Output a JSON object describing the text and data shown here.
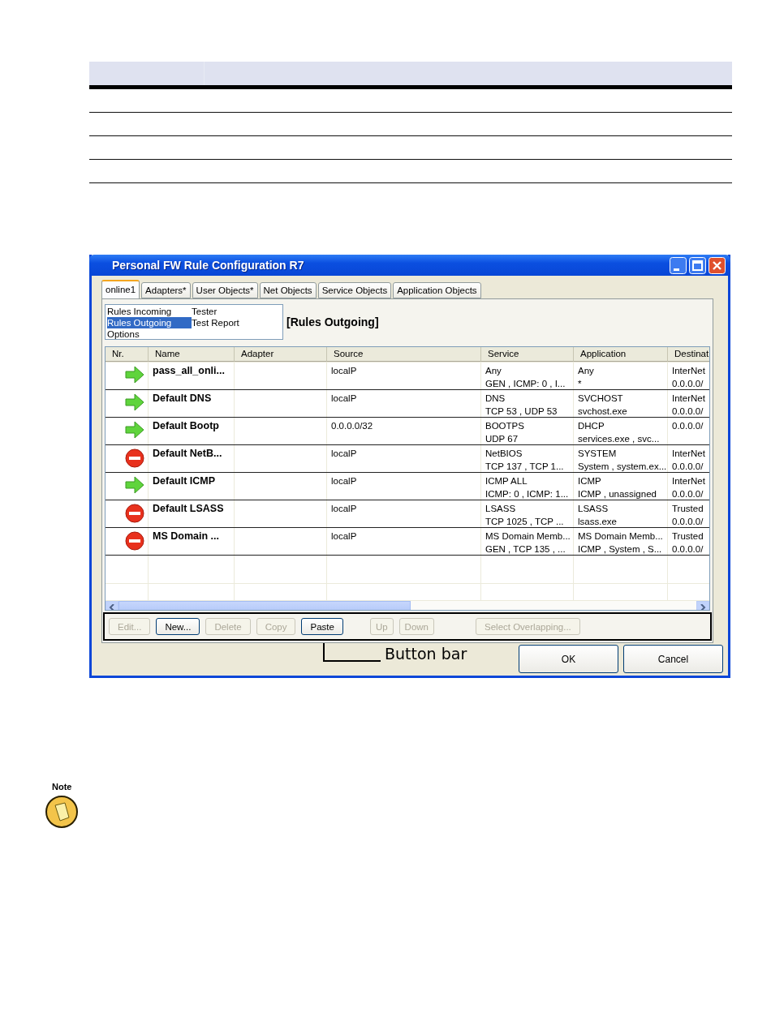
{
  "window": {
    "title": "Personal FW Rule Configuration R7"
  },
  "tabs": [
    {
      "label": "online1",
      "selected": true
    },
    {
      "label": "Adapters*",
      "selected": false
    },
    {
      "label": "User Objects*",
      "selected": false
    },
    {
      "label": "Net Objects",
      "selected": false
    },
    {
      "label": "Service Objects",
      "selected": false
    },
    {
      "label": "Application Objects",
      "selected": false
    }
  ],
  "view_list": {
    "columns": [
      [
        {
          "label": "Rules Incoming",
          "selected": false
        },
        {
          "label": "Rules Outgoing",
          "selected": true
        },
        {
          "label": "Options",
          "selected": false
        }
      ],
      [
        {
          "label": "Tester",
          "selected": false
        },
        {
          "label": "Test Report",
          "selected": false
        }
      ]
    ]
  },
  "heading": "[Rules Outgoing]",
  "table": {
    "columns": [
      "Nr.",
      "Name",
      "Adapter",
      "Source",
      "Service",
      "Application",
      "Destinat"
    ],
    "rows": [
      {
        "kind": "allow",
        "name": "pass_all_onli...",
        "source": [
          "localP"
        ],
        "service": [
          "Any",
          "GEN  , ICMP: 0 , I..."
        ],
        "application": [
          "Any",
          "*"
        ],
        "destination": [
          "InterNet",
          "0.0.0.0/"
        ]
      },
      {
        "kind": "allow",
        "name": "Default DNS",
        "source": [
          "localP"
        ],
        "service": [
          "DNS",
          "TCP  53 , UDP  53"
        ],
        "application": [
          "SVCHOST",
          "svchost.exe"
        ],
        "destination": [
          "InterNet",
          "0.0.0.0/"
        ]
      },
      {
        "kind": "allow",
        "name": "Default Bootp",
        "source": [
          "0.0.0.0/32"
        ],
        "service": [
          "BOOTPS",
          "UDP  67"
        ],
        "application": [
          "DHCP",
          "services.exe , svc..."
        ],
        "destination": [
          "0.0.0.0/"
        ]
      },
      {
        "kind": "block",
        "name": "Default NetB...",
        "source": [
          "localP"
        ],
        "service": [
          "NetBIOS",
          "TCP  137 , TCP  1..."
        ],
        "application": [
          "SYSTEM",
          "System , system.ex..."
        ],
        "destination": [
          "InterNet",
          "0.0.0.0/"
        ]
      },
      {
        "kind": "allow",
        "name": "Default ICMP",
        "source": [
          "localP"
        ],
        "service": [
          "ICMP ALL",
          "ICMP: 0 , ICMP: 1..."
        ],
        "application": [
          "ICMP",
          "ICMP , unassigned"
        ],
        "destination": [
          "InterNet",
          "0.0.0.0/"
        ]
      },
      {
        "kind": "block",
        "name": "Default LSASS",
        "source": [
          "localP"
        ],
        "service": [
          "LSASS",
          "TCP  1025 , TCP  ..."
        ],
        "application": [
          "LSASS",
          "lsass.exe"
        ],
        "destination": [
          "Trusted",
          "0.0.0.0/"
        ]
      },
      {
        "kind": "block",
        "name": "MS Domain ...",
        "source": [
          "localP"
        ],
        "service": [
          "MS Domain Memb...",
          "GEN  , TCP  135 , ..."
        ],
        "application": [
          "MS Domain Memb...",
          "ICMP , System , S..."
        ],
        "destination": [
          "Trusted",
          "0.0.0.0/"
        ]
      }
    ]
  },
  "button_bar": [
    {
      "label": "Edit...",
      "disabled": true
    },
    {
      "label": "New...",
      "disabled": false
    },
    {
      "label": "Delete",
      "disabled": true
    },
    {
      "label": "Copy",
      "disabled": true
    },
    {
      "label": "Paste",
      "disabled": false
    },
    {
      "label": "Up",
      "disabled": true
    },
    {
      "label": "Down",
      "disabled": true
    },
    {
      "label": "Select Overlapping...",
      "disabled": true
    }
  ],
  "dialog_buttons": [
    "OK",
    "Cancel"
  ],
  "callout": "Button bar",
  "note": {
    "label": "Note"
  }
}
